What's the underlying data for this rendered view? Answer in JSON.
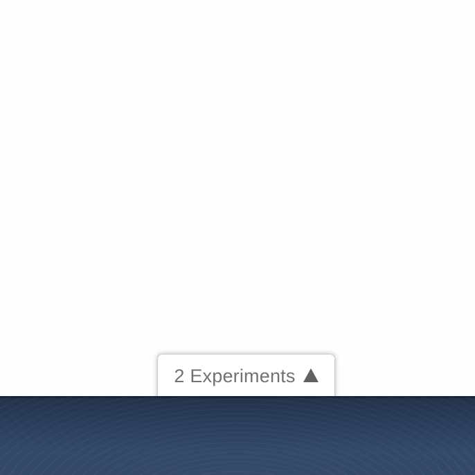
{
  "experiments_tab": {
    "label": "2 Experiments",
    "arrow_icon": "triangle-up-icon"
  },
  "colors": {
    "page_background": "#fdfefd",
    "tab_text": "#6f7173",
    "panel_top": "#223149",
    "panel_bottom": "#34496a"
  }
}
